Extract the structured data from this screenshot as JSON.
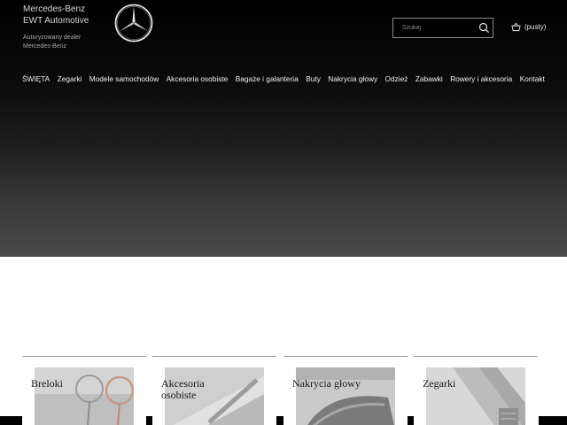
{
  "brand": {
    "name_line1": "Mercedes-Benz",
    "name_line2": "EWT Automotive",
    "dealer_line1": "Autoryzowany dealer",
    "dealer_line2": "Mercedes-Benz",
    "logo_icon": "mercedes-star-icon"
  },
  "search": {
    "placeholder": "Szukaj",
    "value": "",
    "icon": "search-icon"
  },
  "cart": {
    "label": "(pusty)",
    "icon": "basket-icon"
  },
  "nav": {
    "items": [
      {
        "label": "ŚWIĘTA"
      },
      {
        "label": "Zegarki"
      },
      {
        "label": "Modele samochodów"
      },
      {
        "label": "Akcesoria osobiste"
      },
      {
        "label": "Bagaże i galanteria"
      },
      {
        "label": "Buty"
      },
      {
        "label": "Nakrycia głowy"
      },
      {
        "label": "Odzież"
      },
      {
        "label": "Zabawki"
      },
      {
        "label": "Rowery i akcesoria"
      },
      {
        "label": "Kontakt"
      }
    ]
  },
  "categories": [
    {
      "label": "Breloki"
    },
    {
      "label": "Akcesoria osobiste"
    },
    {
      "label": "Nakrycia głowy"
    },
    {
      "label": "Zegarki"
    }
  ],
  "colors": {
    "hero_top": "#000000",
    "hero_bottom": "#4a4a4a",
    "nav_text": "#f0f0f0",
    "card_text": "#1a1a1a"
  }
}
